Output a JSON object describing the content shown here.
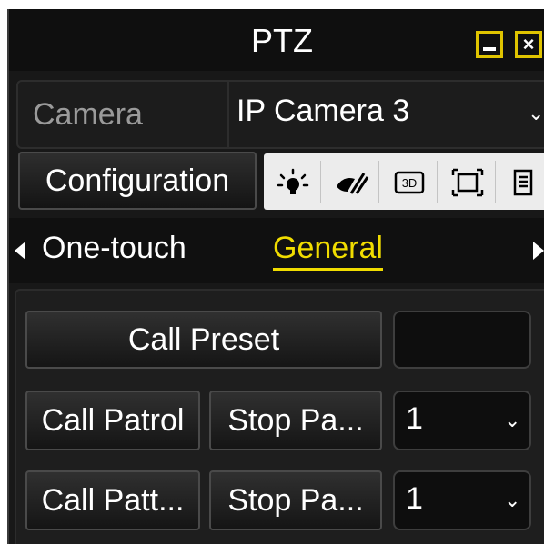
{
  "window": {
    "title": "PTZ",
    "minimize_icon": "minimize-icon",
    "close_icon": "close-icon",
    "accent_color": "#e0c400"
  },
  "camera": {
    "label": "Camera",
    "selected": "IP Camera 3"
  },
  "toolbar": {
    "configuration_label": "Configuration",
    "icons": [
      "light-icon",
      "wiper-icon",
      "3d-zoom-icon",
      "lens-init-icon",
      "menu-list-icon"
    ],
    "three_d_text": "3D"
  },
  "tabs": {
    "items": [
      {
        "label": "One-touch",
        "active": false
      },
      {
        "label": "General",
        "active": true
      }
    ],
    "active_color": "#f0dc00"
  },
  "general": {
    "call_preset_label": "Call Preset",
    "preset_value": "",
    "call_patrol_label": "Call Patrol",
    "stop_patrol_label": "Stop Pa...",
    "patrol_selected": "1",
    "call_pattern_label": "Call Patt...",
    "stop_pattern_label": "Stop Pa...",
    "pattern_selected": "1"
  }
}
